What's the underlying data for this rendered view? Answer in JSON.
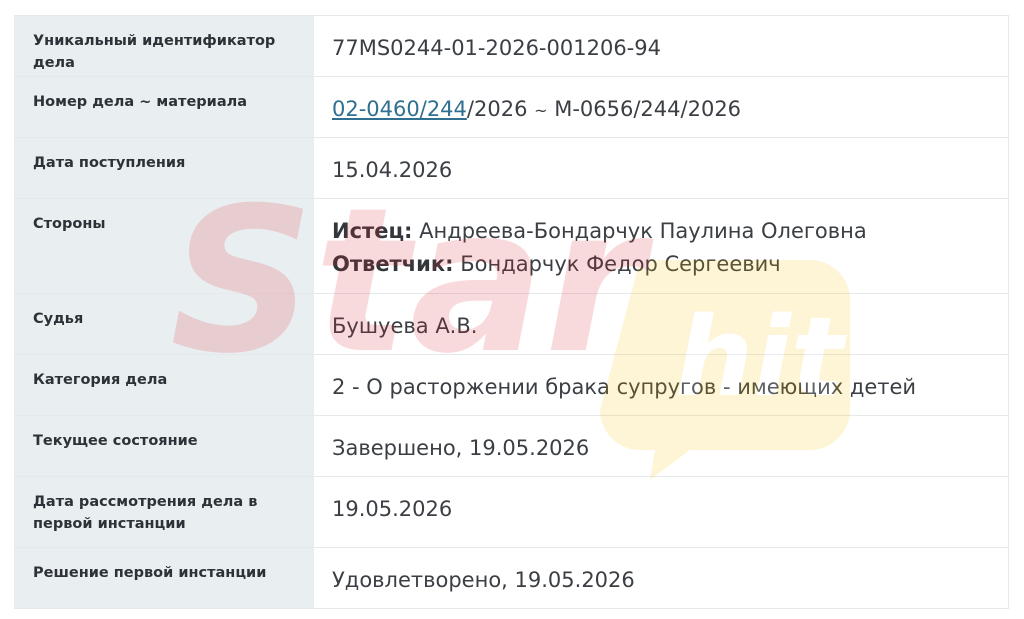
{
  "rows": [
    {
      "label": "Уникальный идентификатор дела",
      "value": "77MS0244-01-2026-001206-94"
    },
    {
      "label": "Номер дела ~ материала",
      "link": "02-0460/244",
      "link_suffix": "/2026",
      "tilde": "~",
      "material": "М-0656/244/2026"
    },
    {
      "label": "Дата поступления",
      "value": "15.04.2026"
    },
    {
      "label": "Стороны",
      "plaintiff_role": "Истец:",
      "plaintiff_name": "Андреева-Бондарчук Паулина Олеговна",
      "defendant_role": "Ответчик:",
      "defendant_name": "Бондарчук Федор Сергеевич"
    },
    {
      "label": "Судья",
      "value": "Бушуева А.В."
    },
    {
      "label": "Категория дела",
      "value": "2 - О расторжении брака супругов - имеющих детей"
    },
    {
      "label": "Текущее состояние",
      "value": "Завершено, 19.05.2026"
    },
    {
      "label": "Дата рассмотрения дела в первой инстанции",
      "value": "19.05.2026"
    },
    {
      "label": "Решение первой инстанции",
      "value": "Удовлетворено, 19.05.2026"
    }
  ],
  "watermark": {
    "text_main": "Star",
    "text_badge": "hit",
    "color_main": "#e0202a",
    "color_badge": "#f5c400"
  }
}
